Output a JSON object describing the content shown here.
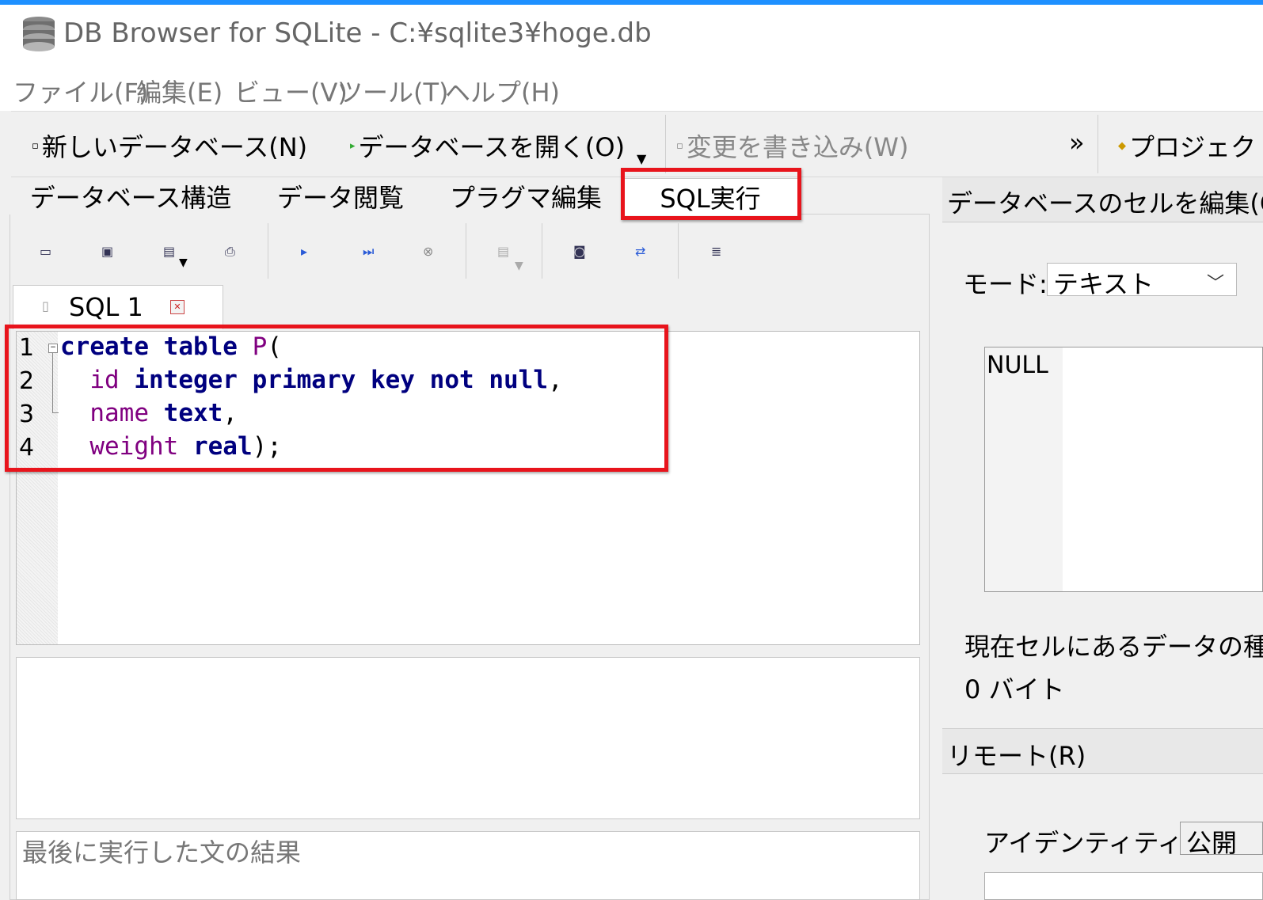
{
  "window": {
    "title": "DB Browser for SQLite - C:¥sqlite3¥hoge.db"
  },
  "menu": {
    "items": [
      "ファイル(F)",
      "編集(E)",
      "ビュー(V)",
      "ツール(T)",
      "ヘルプ(H)"
    ]
  },
  "toolbar": {
    "new_db": "新しいデータベース(N)",
    "open_db": "データベースを開く(O)",
    "write_changes": "変更を書き込み(W)",
    "overflow": "»",
    "project": "プロジェク"
  },
  "tabs": [
    "データベース構造",
    "データ閲覧",
    "プラグマ編集",
    "SQL実行"
  ],
  "editor": {
    "tab_label": "SQL 1",
    "line_numbers": [
      "1",
      "2",
      "3",
      "4"
    ]
  },
  "results": {
    "message": "最後に実行した文の結果"
  },
  "cell_panel": {
    "title": "データベースのセルを編集(C",
    "mode_label": "モード:",
    "mode_value": "テキスト",
    "cell_value": "NULL",
    "type_label": "現在セルにあるデータの種",
    "size_label": "0 バイト"
  },
  "remote_panel": {
    "title": "リモート(R)",
    "identity_label": "アイデンティティー",
    "identity_value": "公開"
  },
  "colors": {
    "highlight": "#e8141c",
    "keyword": "#00007f",
    "identifier": "#800080"
  },
  "icons": [
    "database-icon",
    "new-db-icon",
    "open-db-icon",
    "write-changes-icon",
    "project-icon",
    "open-tab-icon",
    "save-icon",
    "save-as-icon",
    "print-icon",
    "execute-icon",
    "execute-line-icon",
    "stop-icon",
    "save-results-icon",
    "find-icon",
    "find-replace-icon",
    "comment-icon",
    "close-icon",
    "chevron-down-icon"
  ]
}
